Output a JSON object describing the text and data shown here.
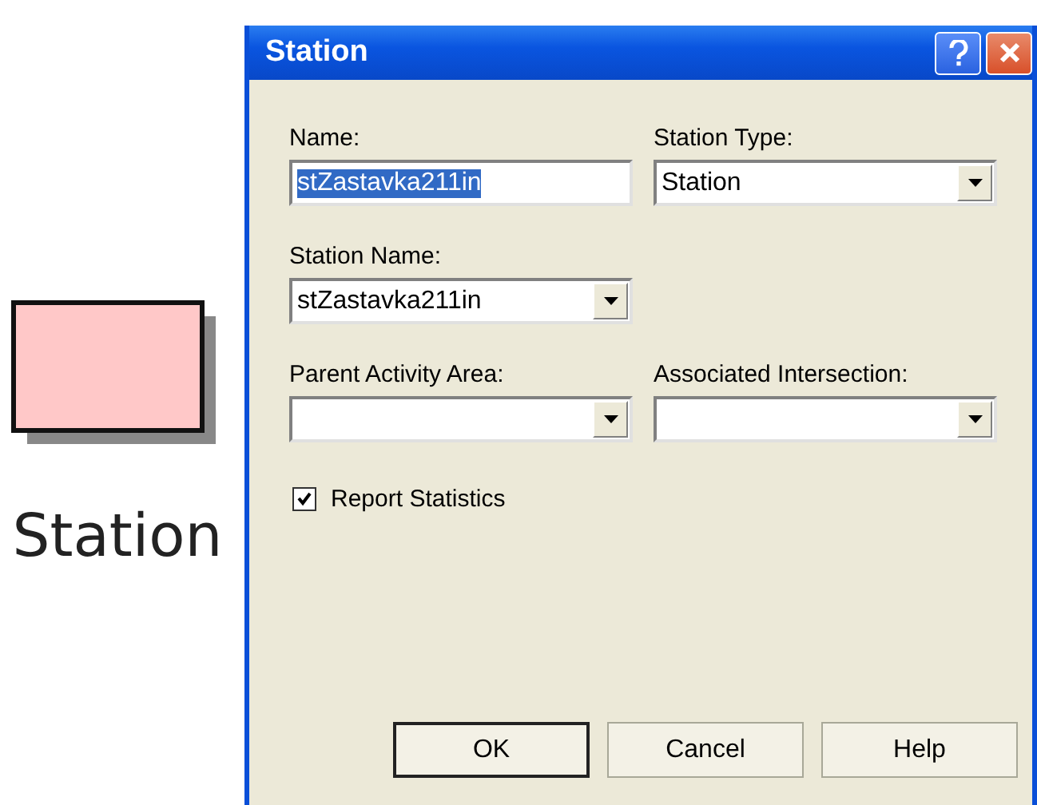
{
  "canvas": {
    "shape_label": "Station"
  },
  "window": {
    "title": "Station"
  },
  "fields": [
    {
      "kind": "text",
      "label": "Name:",
      "value": "stZastavka211in",
      "text_selected": true
    },
    {
      "kind": "combo",
      "label": "Station Type:",
      "value": "Station"
    },
    {
      "kind": "combo",
      "label": "Station Name:",
      "value": "stZastavka211in"
    },
    {
      "kind": "spacer"
    },
    {
      "kind": "combo",
      "label": "Parent Activity Area:"
    },
    {
      "kind": "combo",
      "label": "Associated Intersection:"
    }
  ],
  "checkbox": {
    "label": "Report Statistics",
    "checked": true
  },
  "buttons": [
    {
      "label": "OK",
      "default": true
    },
    {
      "label": "Cancel",
      "default": false
    },
    {
      "label": "Help",
      "default": false
    }
  ]
}
